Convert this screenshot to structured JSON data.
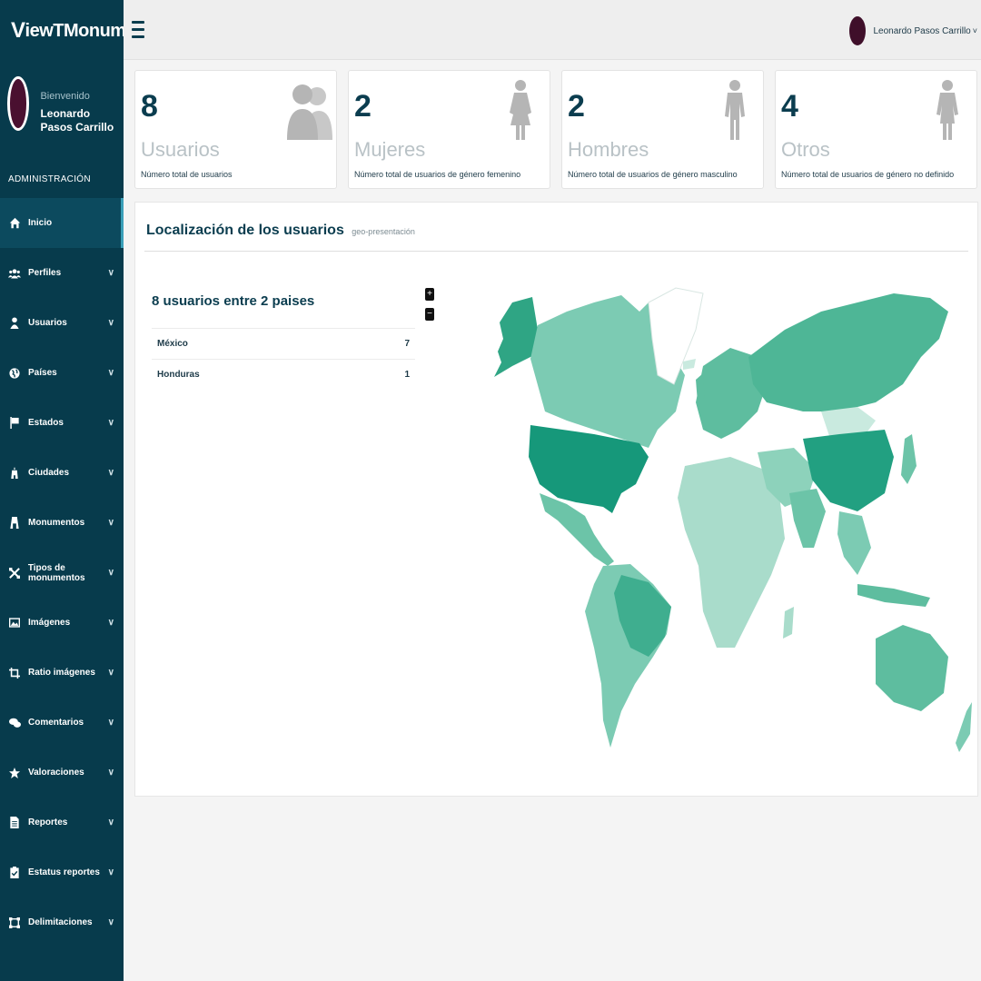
{
  "app": {
    "brand_v": "V",
    "brand_rest": "iewTMonument"
  },
  "profile": {
    "welcome": "Bienvenido",
    "name": "Leonardo Pasos Carrillo"
  },
  "sidebar": {
    "section": "ADMINISTRACIÓN",
    "items": [
      {
        "label": "Inicio",
        "icon": "home-icon"
      },
      {
        "label": "Perfiles",
        "icon": "users-group-icon"
      },
      {
        "label": "Usuarios",
        "icon": "user-icon"
      },
      {
        "label": "Países",
        "icon": "globe-icon"
      },
      {
        "label": "Estados",
        "icon": "flag-icon"
      },
      {
        "label": "Ciudades",
        "icon": "city-icon"
      },
      {
        "label": "Monumentos",
        "icon": "monument-icon"
      },
      {
        "label": "Tipos de monumentos",
        "icon": "types-icon"
      },
      {
        "label": "Imágenes",
        "icon": "image-icon"
      },
      {
        "label": "Ratio imágenes",
        "icon": "crop-icon"
      },
      {
        "label": "Comentarios",
        "icon": "comments-icon"
      },
      {
        "label": "Valoraciones",
        "icon": "star-icon"
      },
      {
        "label": "Reportes",
        "icon": "report-icon"
      },
      {
        "label": "Estatus reportes",
        "icon": "clipboard-check-icon"
      },
      {
        "label": "Delimitaciones",
        "icon": "bounds-icon"
      }
    ]
  },
  "topbar": {
    "user_name": "Leonardo Pasos Carrillo",
    "caret": "˅"
  },
  "stats": [
    {
      "value": "8",
      "label": "Usuarios",
      "desc": "Número total de usuarios",
      "icon": "users-icon"
    },
    {
      "value": "2",
      "label": "Mujeres",
      "desc": "Número total de usuarios de género femenino",
      "icon": "female-icon"
    },
    {
      "value": "2",
      "label": "Hombres",
      "desc": "Número total de usuarios de género masculino",
      "icon": "male-icon"
    },
    {
      "value": "4",
      "label": "Otros",
      "desc": "Número total de usuarios de género no definido",
      "icon": "person-icon"
    }
  ],
  "map_panel": {
    "title": "Localización de los usuarios",
    "subtitle": "geo-presentación",
    "summary": "8 usuarios entre 2 paises",
    "countries": [
      {
        "name": "México",
        "count": "7"
      },
      {
        "name": "Honduras",
        "count": "1"
      }
    ],
    "zoom_in": "+",
    "zoom_out": "−"
  },
  "colors": {
    "sidebar": "#073b4c",
    "accent": "#1a9b7c",
    "map_light": "#a9dccb",
    "map_mid": "#6cc4a8"
  }
}
